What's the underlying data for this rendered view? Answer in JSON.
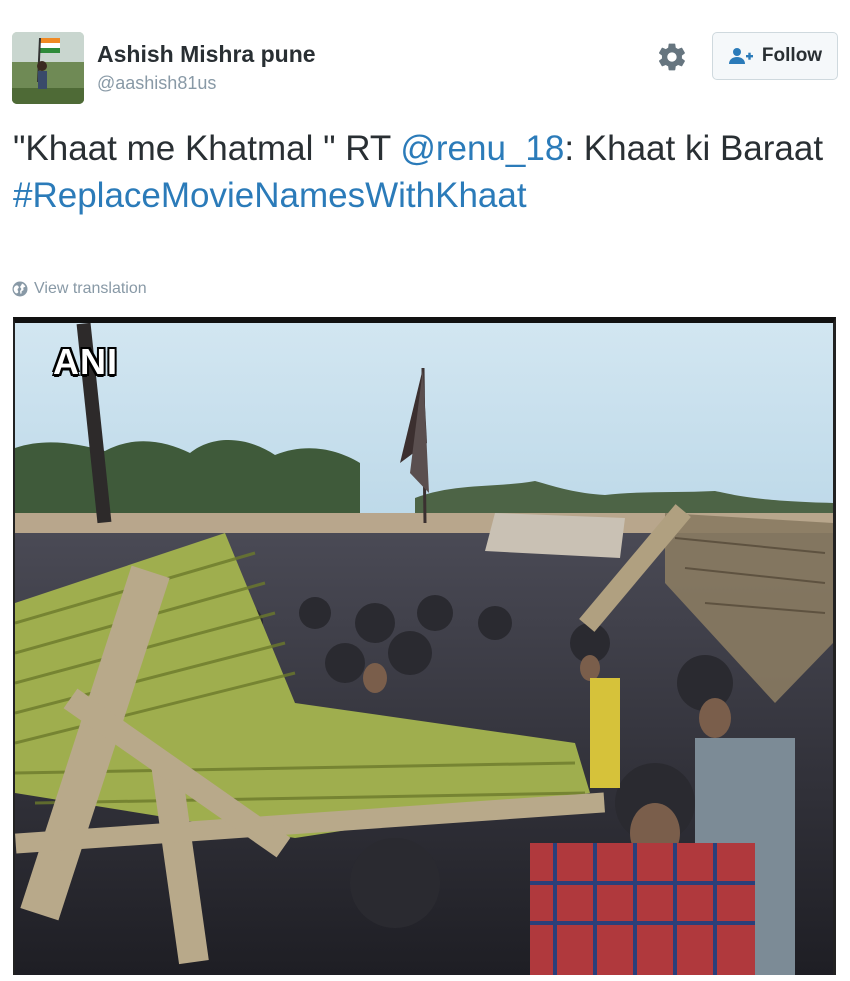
{
  "author": {
    "name": "Ashish Mishra pune",
    "handle": "@aashish81us"
  },
  "actions": {
    "settings_icon": "gear-icon",
    "follow_label": "Follow",
    "follow_icon": "add-user-icon"
  },
  "tweet": {
    "text_part1": "\"Khaat me Khatmal \" RT ",
    "mention": "@renu_18",
    "text_part2": ": Khaat ki Baraat",
    "hashtag": "#ReplaceMovieNamesWithKhaat"
  },
  "translation": {
    "label": "View translation",
    "icon": "globe-icon"
  },
  "media": {
    "watermark": "ANI",
    "description_icon": "photo"
  },
  "colors": {
    "link": "#2b7bb9",
    "text": "#292f33",
    "muted": "#8899a6"
  }
}
